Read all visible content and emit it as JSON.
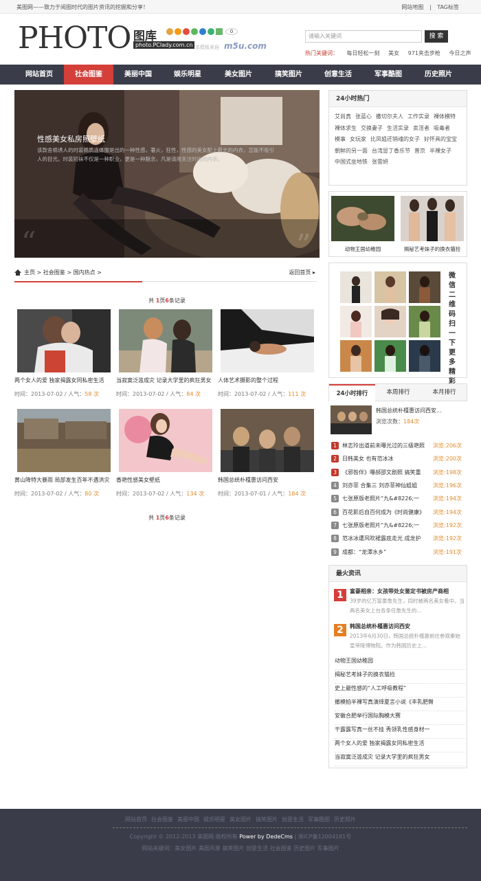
{
  "topbar": {
    "slogan": "美图网——致力于阅图时代的图片资讯的挖掘和分享！",
    "links": [
      "网站地图",
      "TAG标签"
    ]
  },
  "brand": {
    "logo_word": "PHOTO",
    "logo_cn": "图库",
    "domain": "photo.PCIady.com.cn",
    "share_count": "0",
    "small_text": "本模板来自",
    "m5u": "m5u.com"
  },
  "search": {
    "placeholder": "请输入关键词",
    "button": "搜 索",
    "hot_label": "热门关键词：",
    "hot_words": [
      "每日轻松一刻",
      "美女",
      "971夹击步枪",
      "今日之声"
    ]
  },
  "nav": [
    "网站首页",
    "社会图鉴",
    "美丽中国",
    "娱乐明星",
    "美女图片",
    "搞笑图片",
    "创意生活",
    "军事酷图",
    "历史照片"
  ],
  "hero": {
    "title": "性感美女私房照壁纸",
    "desc": "该款舍棉诱人的时装棉质连体服是出的一种性感，著火，狂性，性感的美女配上最光的内衣，怎能不吸引人的目光。时装短袜不仅是一种职业，更是一种魅念，凡是请用关注时尚的内衣。"
  },
  "breadcrumb": {
    "path": "主页 > 社会图鉴 > 国内热点 >",
    "back": "返回首页"
  },
  "pager": {
    "pre": "共",
    "pages": "1",
    "mid": "页",
    "count": "6",
    "post": "条记录"
  },
  "meta_labels": {
    "time": "时间：",
    "sep": " / 人气：",
    "unit": " 次"
  },
  "articles": [
    {
      "title": "两个女人的爱 独家揭露女同私密生活",
      "date": "2013-07-02",
      "views": "58"
    },
    {
      "title": "当寂寞泛滥成灾 记录大学里的疯狂男女",
      "date": "2013-07-02",
      "views": "84"
    },
    {
      "title": "人体艺术摄影的整个过程",
      "date": "2013-07-02",
      "views": "111"
    },
    {
      "title": "黄山降特大暴雨 局部发生百年不遇洪灾",
      "date": "2013-07-02",
      "views": "80"
    },
    {
      "title": "香艳性感美女壁纸",
      "date": "2013-07-02",
      "views": "134"
    },
    {
      "title": "韩国总统朴槿惠访问西安",
      "date": "2013-07-01",
      "views": "184"
    }
  ],
  "hot24": {
    "title": "24小时热门",
    "tags": [
      "艾尚真",
      "张蓝心",
      "撒切尔夫人",
      "工作实录",
      "裸体模特",
      "裸体求生",
      "交换妻子",
      "生活实录",
      "卖淫者",
      "吸毒者",
      "模事",
      "女玩家",
      "比凤姐还销魂的女子",
      "好怀具的宝宝",
      "朝鲜的另一面",
      "台湾显丁香乐节",
      "普京",
      "半裸女子",
      "中国式坐地铁",
      "张雲妍"
    ]
  },
  "pair": [
    {
      "caption": "动物王国幼稚园"
    },
    {
      "caption": "揭秘艺考妹子的换衣猫捡"
    }
  ],
  "wechat": {
    "text": "微信二维码扫一下更多精彩"
  },
  "rank": {
    "tabs": [
      "24小时排行",
      "本周排行",
      "本月排行"
    ],
    "top": {
      "title": "韩国总统朴槿惠访问西安...",
      "views_label": "浏览次数：",
      "views": "184次"
    },
    "items": [
      {
        "n": "1",
        "title": "林志玲出道前未曝光过的三级艳照",
        "v": "浏览:206次"
      },
      {
        "n": "2",
        "title": "日韩美女 也有范冰冰",
        "v": "浏览:200次"
      },
      {
        "n": "3",
        "title": "《邪咎伴》曝郝邵文剧照 搞笑重",
        "v": "浏览:198次"
      },
      {
        "n": "4",
        "title": "刘亦菲 合集三  刘亦菲神仙姐姐",
        "v": "浏览:196次"
      },
      {
        "n": "5",
        "title": "七张原版老照片“九&#8226;一",
        "v": "浏览:194次"
      },
      {
        "n": "6",
        "title": "百花影后自百何成为《时尚健康》",
        "v": "浏览:194次"
      },
      {
        "n": "7",
        "title": "七张原版老照片“九&#8226;一",
        "v": "浏览:192次"
      },
      {
        "n": "8",
        "title": "范冰冰遭风吹裙露底走光 成龙护",
        "v": "浏览:192次"
      },
      {
        "n": "9",
        "title": "成都：“龙潭水乡”",
        "v": "浏览:191次"
      }
    ]
  },
  "news": {
    "title": "最火资讯",
    "featured": [
      {
        "n": "1",
        "title": "富豪相亲：女孩带处女鉴定书被房产商相",
        "desc": "39岁的亿万富豪詹先生，同时被两名美女看中。当两名美女上台各条任詹先生的..."
      },
      {
        "n": "2",
        "title": "韩国总统朴槿惠访问西安",
        "desc": "2013年6月30日，韩国总统朴槿惠前往参观秦始皇帝陵博物院。作为韩国历史上..."
      }
    ],
    "list": [
      "动物王国幼稚园",
      "揭秘艺考妹子的换衣猫捡",
      "史上最性感的“人工呼吸教程”",
      "撤模拍半裸写真演绎夏言小说《丰乳肥臀",
      "安徽合肥举行国际胸模大赛",
      "干露露写真一丝不挂 秀领乳性感身材一",
      "两个女人的爱 独家揭露女同私密生活",
      "当寂寞泛滥成灾 记录大学里的疯狂男女"
    ]
  },
  "footer": {
    "nav": [
      "网站首页",
      "社会图鉴",
      "美丽中国",
      "娱乐明星",
      "美女图片",
      "搞笑图片",
      "创意生活",
      "军事酷图",
      "历史照片"
    ],
    "copyright": "Copyright © 2012-2013 美图网 版权所有",
    "power": "Power by DedeCms",
    "icp": "| 浙ICP备12004181号",
    "keywords": "网站关键词：美女图片 美图风景 搞笑图片 创意生活 社会图鉴 历史图片 军事图片"
  },
  "colors": {
    "accent": "#d43f3a",
    "nav_bg": "#3a3d49",
    "highlight": "#e08a2a"
  }
}
